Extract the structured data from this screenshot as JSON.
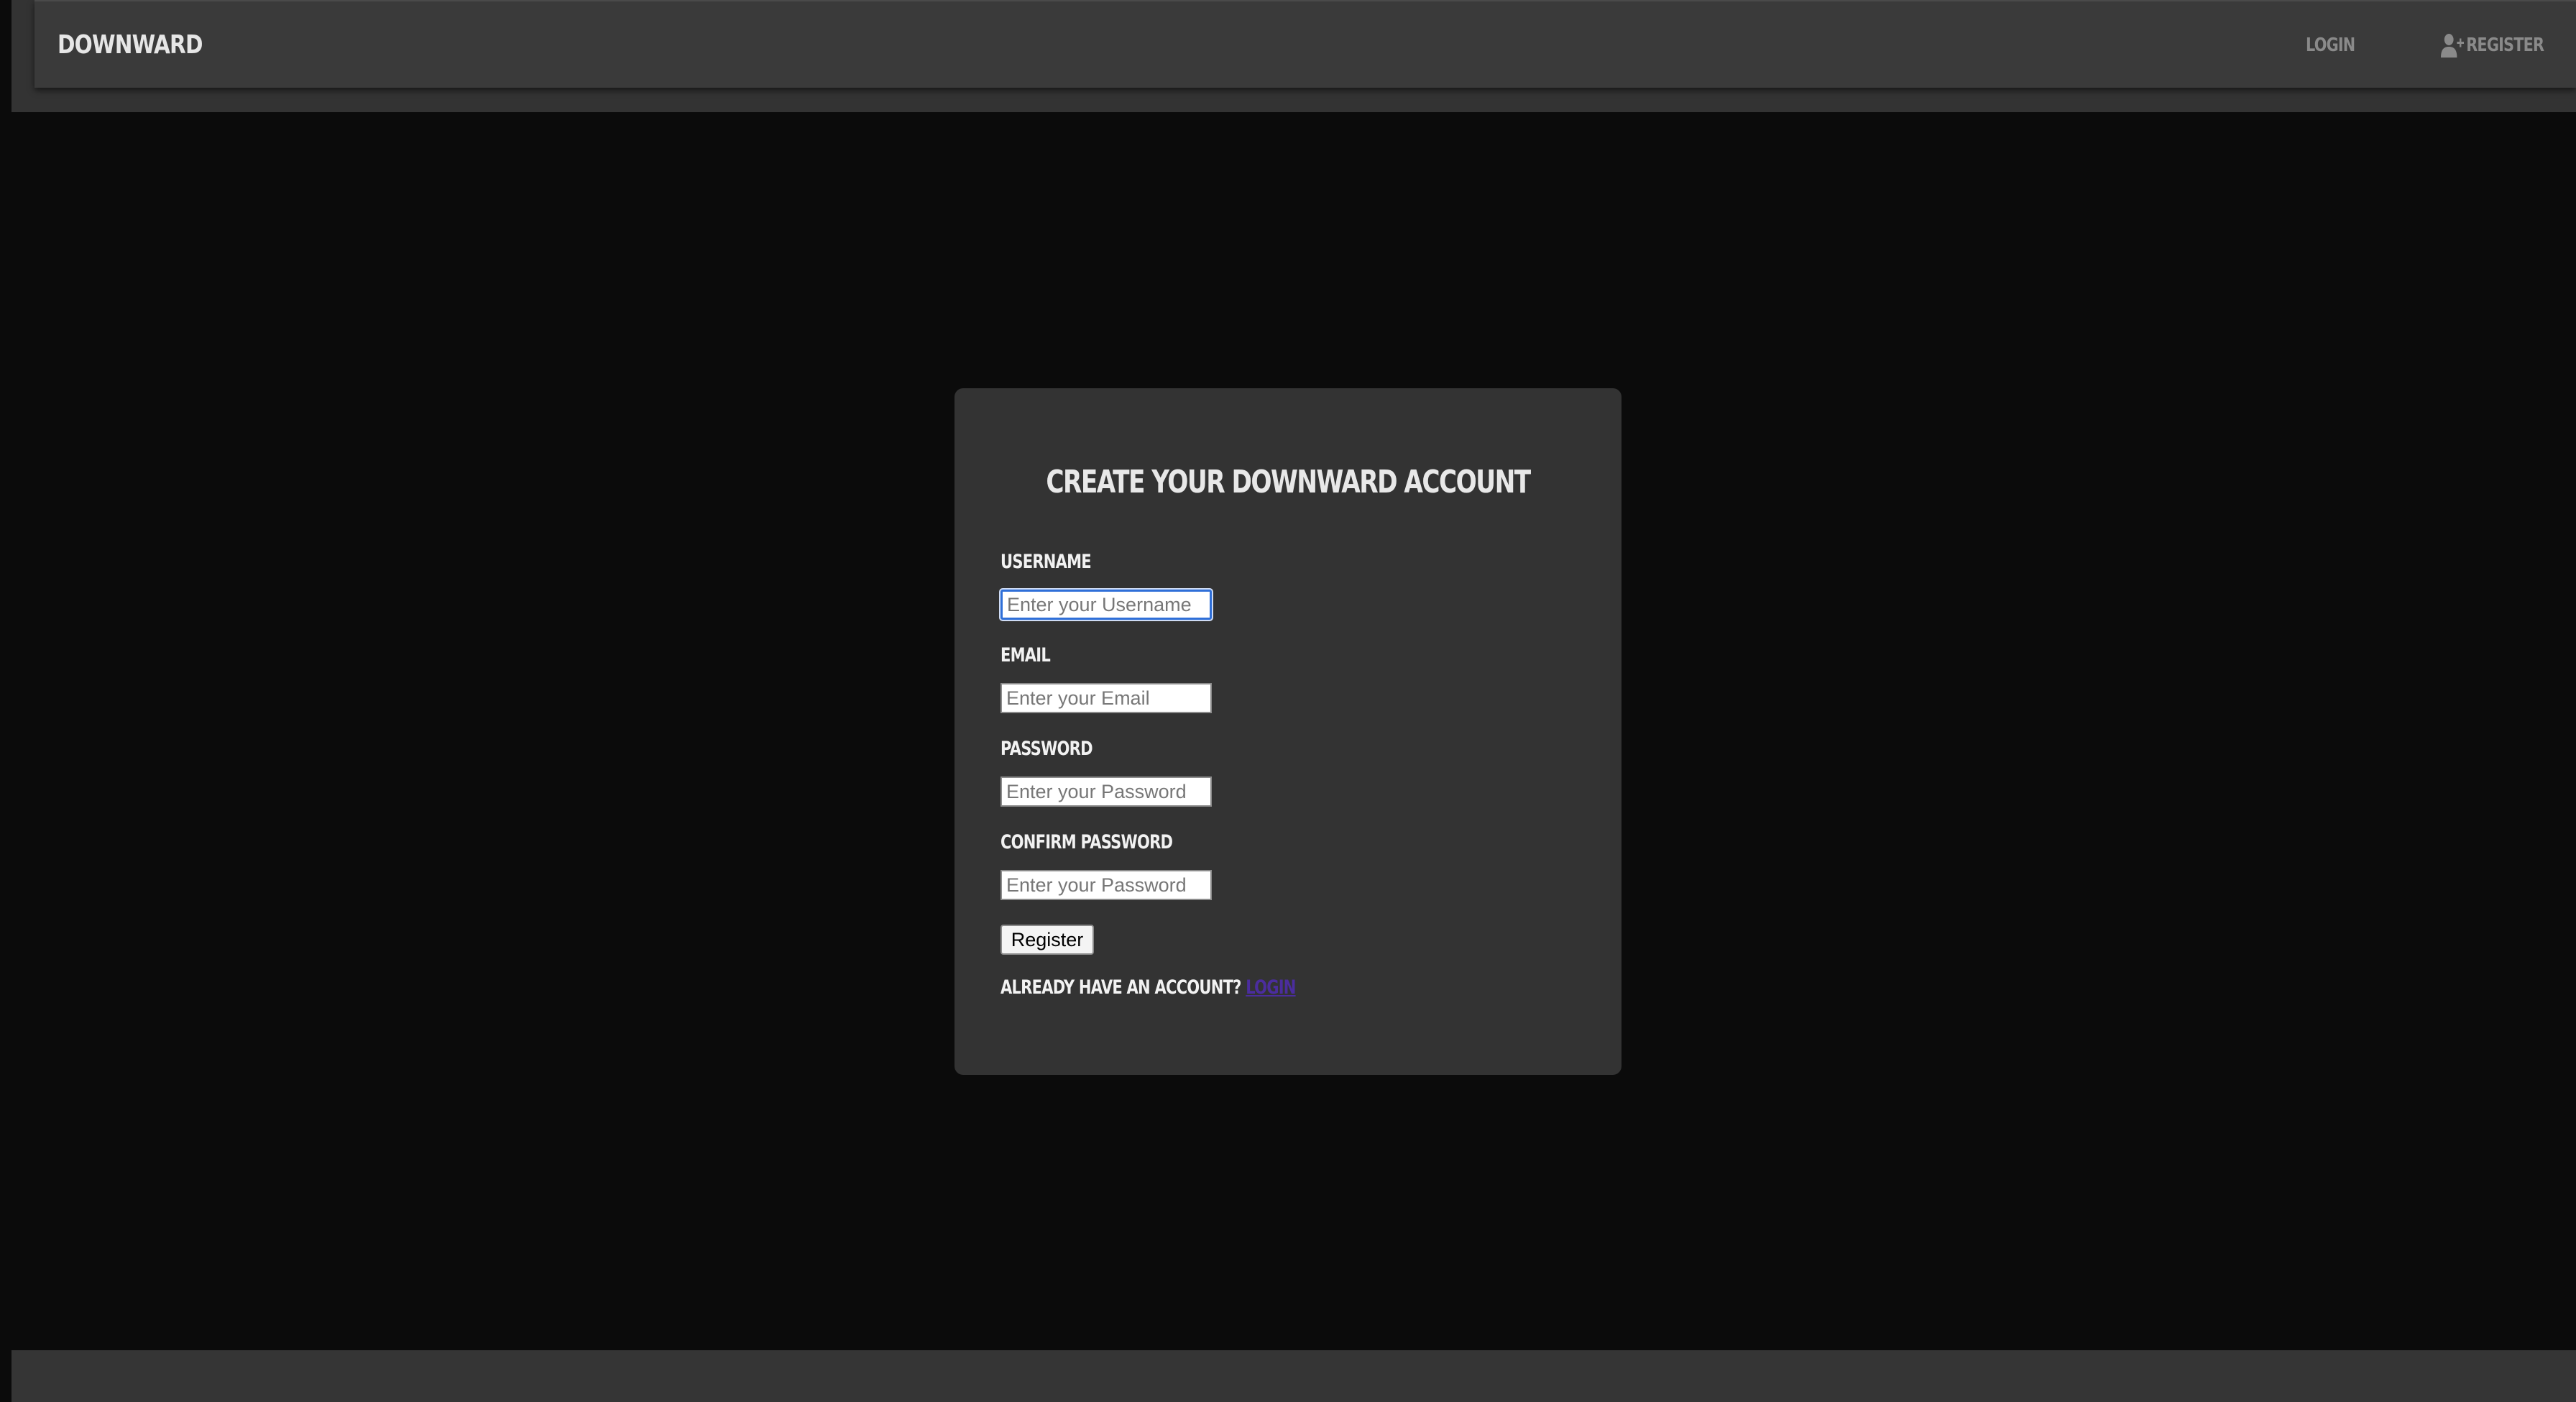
{
  "header": {
    "brand": "DOWNWARD",
    "nav": {
      "login": "LOGIN",
      "register": "REGISTER",
      "register_icon": "user-plus-icon"
    }
  },
  "form": {
    "title": "CREATE YOUR DOWNWARD ACCOUNT",
    "fields": [
      {
        "label": "USERNAME",
        "placeholder": "Enter your Username",
        "value": ""
      },
      {
        "label": "EMAIL",
        "placeholder": "Enter your Email",
        "value": ""
      },
      {
        "label": "PASSWORD",
        "placeholder": "Enter your Password",
        "value": ""
      },
      {
        "label": "CONFIRM PASSWORD",
        "placeholder": "Enter your Password",
        "value": ""
      }
    ],
    "submit_label": "Register",
    "login_prompt": "ALREADY HAVE AN ACCOUNT?",
    "login_link": "LOGIN"
  },
  "colors": {
    "background": "#0b0b0b",
    "panel": "#333333",
    "navbar": "#3a3a3a",
    "link": "#4b2d9e",
    "focus": "#2f6fd8"
  }
}
